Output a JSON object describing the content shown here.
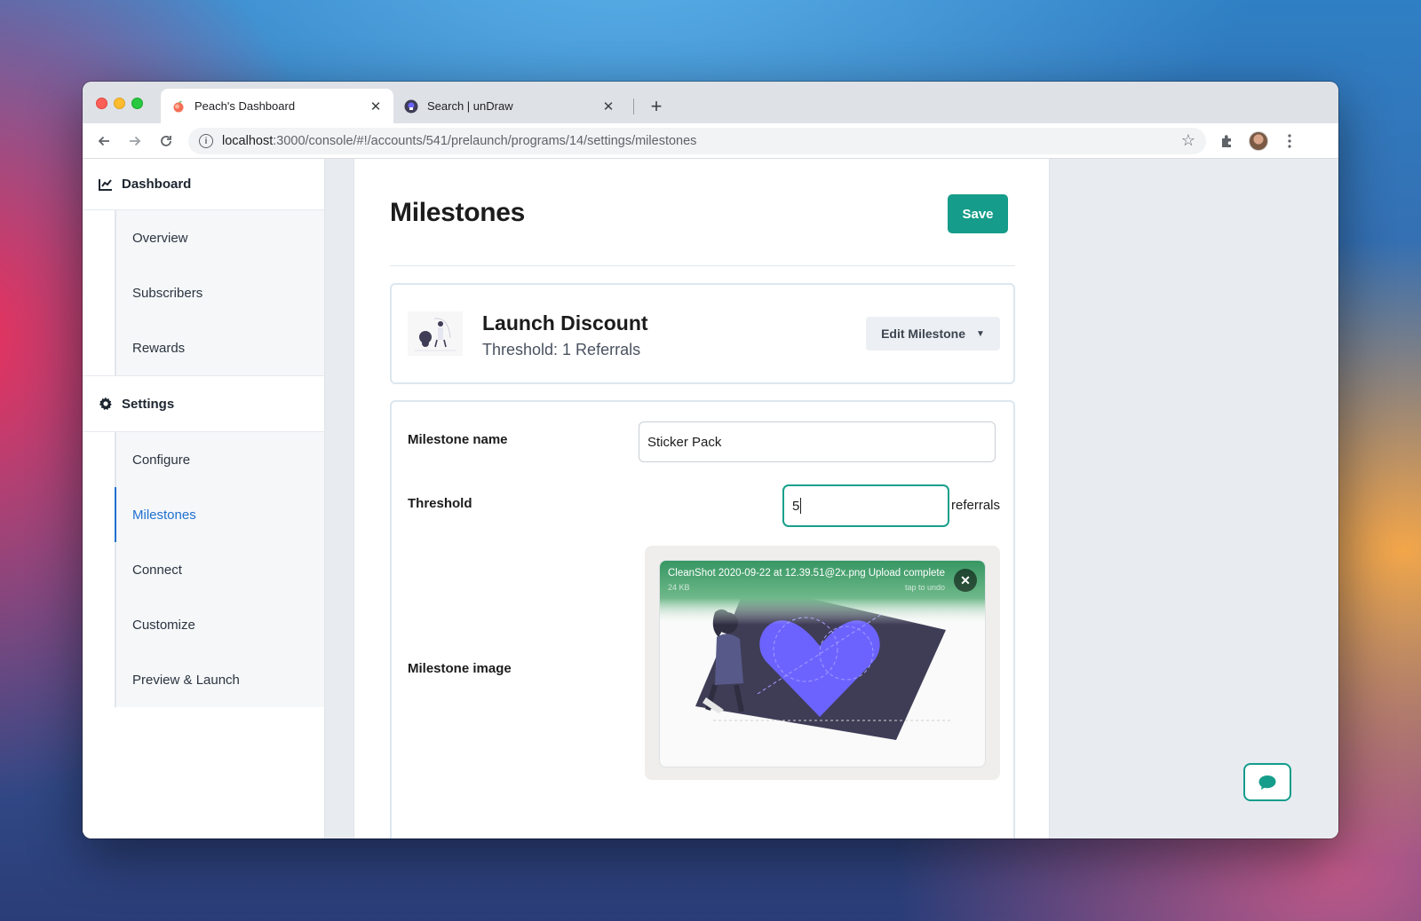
{
  "browser": {
    "tabs": [
      {
        "title": "Peach's Dashboard",
        "favicon": "peach-icon",
        "active": true
      },
      {
        "title": "Search | unDraw",
        "favicon": "undraw-icon",
        "active": false
      }
    ],
    "url_host": "localhost",
    "url_path": ":3000/console/#!/accounts/541/prelaunch/programs/14/settings/milestones"
  },
  "sidebar": {
    "dashboard_label": "Dashboard",
    "dashboard_items": [
      {
        "label": "Overview"
      },
      {
        "label": "Subscribers"
      },
      {
        "label": "Rewards"
      }
    ],
    "settings_label": "Settings",
    "settings_items": [
      {
        "label": "Configure",
        "active": false
      },
      {
        "label": "Milestones",
        "active": true
      },
      {
        "label": "Connect",
        "active": false
      },
      {
        "label": "Customize",
        "active": false
      },
      {
        "label": "Preview & Launch",
        "active": false
      }
    ]
  },
  "main": {
    "title": "Milestones",
    "save_label": "Save",
    "milestone": {
      "name": "Launch Discount",
      "threshold": "Threshold: 1 Referrals",
      "edit_label": "Edit Milestone"
    },
    "form": {
      "name_label": "Milestone name",
      "name_value": "Sticker Pack",
      "threshold_label": "Threshold",
      "threshold_value": "5",
      "threshold_suffix": "referrals",
      "image_label": "Milestone image"
    },
    "upload": {
      "filename": "CleanShot 2020-09-22 at 12.39.51@2x.png",
      "size": "24 KB",
      "status": "Upload complete",
      "undo": "tap to undo"
    }
  },
  "colors": {
    "accent": "#159c8a",
    "active_link": "#1f6fd1",
    "upload_success": "#369763",
    "illustration_primary": "#6c63ff"
  }
}
